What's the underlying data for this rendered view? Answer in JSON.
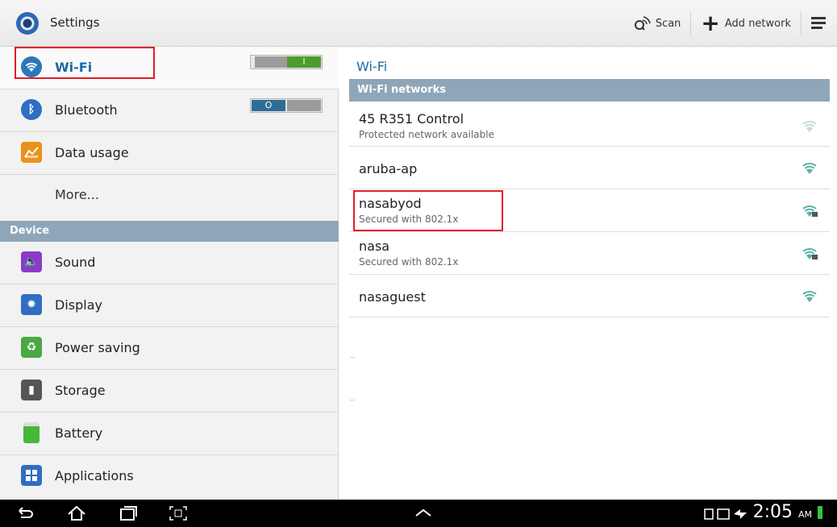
{
  "app": {
    "title": "Settings"
  },
  "actions": {
    "scan": "Scan",
    "add_network": "Add network"
  },
  "sidebar": {
    "items": [
      {
        "label": "Wi-Fi"
      },
      {
        "label": "Bluetooth"
      },
      {
        "label": "Data usage"
      },
      {
        "label": "More..."
      }
    ],
    "section": "Device",
    "device_items": [
      {
        "label": "Sound"
      },
      {
        "label": "Display"
      },
      {
        "label": "Power saving"
      },
      {
        "label": "Storage"
      },
      {
        "label": "Battery"
      },
      {
        "label": "Applications"
      }
    ],
    "wifi_toggle": "I",
    "bluetooth_toggle": "O"
  },
  "wifi": {
    "title": "Wi-Fi",
    "section": "Wi-Fi networks",
    "networks": [
      {
        "name": "45 R351 Control",
        "status": "Protected network available"
      },
      {
        "name": "aruba-ap",
        "status": ""
      },
      {
        "name": "nasabyod",
        "status": "Secured with 802.1x"
      },
      {
        "name": "nasa",
        "status": "Secured with 802.1x"
      },
      {
        "name": "nasaguest",
        "status": ""
      }
    ]
  },
  "status": {
    "time": "2:05",
    "ampm": "AM"
  },
  "colors": {
    "accent": "#1d6aa1",
    "section_bg": "#8fa6b8",
    "highlight": "#e01d2a",
    "toggle_on": "#4c9c2e"
  }
}
